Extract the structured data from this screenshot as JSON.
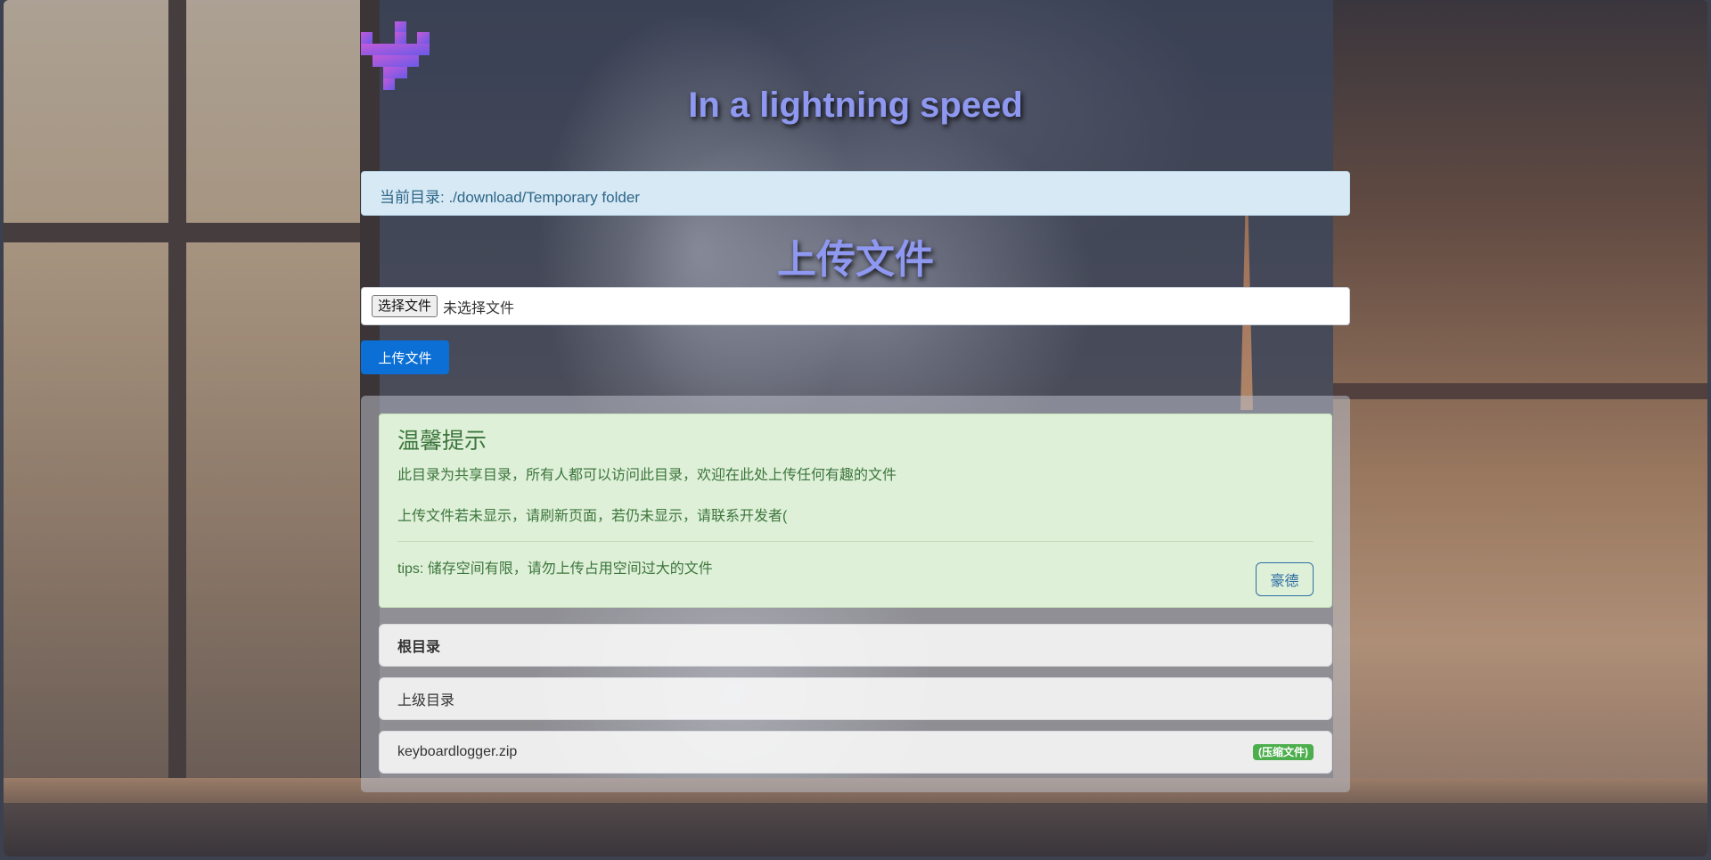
{
  "header": {
    "headline": "In a lightning speed"
  },
  "path_bar": {
    "text": "当前目录: ./download/Temporary folder"
  },
  "upload": {
    "title": "上传文件",
    "choose_file_label": "选择文件",
    "no_file_status": "未选择文件",
    "submit_label": "上传文件"
  },
  "notice": {
    "title": "温馨提示",
    "line1": "此目录为共享目录，所有人都可以访问此目录，欢迎在此处上传任何有趣的文件",
    "line2": "上传文件若未显示，请刷新页面，若仍未显示，请联系开发者(",
    "tips": "tips: 储存空间有限，请勿上传占用空间过大的文件",
    "button_label": "豪德"
  },
  "listing": {
    "root_label": "根目录",
    "parent_label": "上级目录",
    "files": [
      {
        "name": "keyboardlogger.zip",
        "badge": "(压缩文件)"
      }
    ]
  },
  "colors": {
    "headline": "#8f98f0",
    "path_bar_bg": "#d7e9f5",
    "upload_button": "#0b6fd6",
    "alert_bg": "#dff0d8",
    "alert_text": "#3c763d",
    "badge": "#4cae4c"
  }
}
